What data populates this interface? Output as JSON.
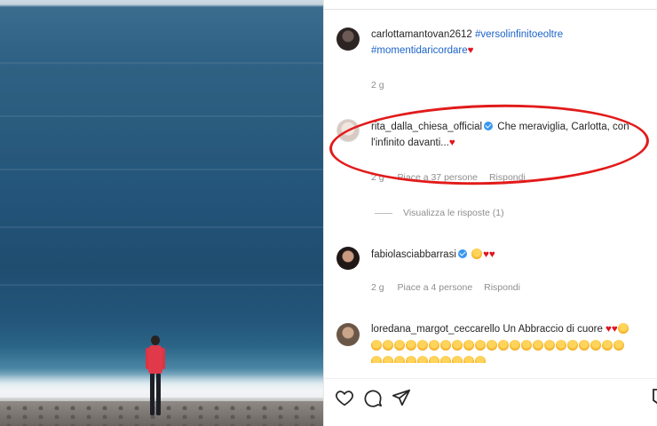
{
  "post": {
    "caption": {
      "user": "carlottamantovan2612",
      "tags": [
        "#versolinfinitoeoltre",
        "#momentidaricordare"
      ],
      "heart": "♥",
      "time": "2 g"
    },
    "comments": [
      {
        "user": "rita_dalla_chiesa_official",
        "text": "Che meraviglia, Carlotta, con l'infinito davanti...",
        "heart": "♥",
        "time": "2 g",
        "likes": "Piace a 37 persone",
        "reply": "Rispondi",
        "view_replies": "Visualizza le risposte (1)"
      },
      {
        "user": "fabiolasciabbarrasi",
        "time": "2 g",
        "likes": "Piace a 4 persone",
        "reply": "Rispondi"
      },
      {
        "user": "loredana_margot_ceccarello",
        "text": "Un Abbraccio di cuore"
      }
    ]
  },
  "actions": {
    "like_icon": "heart-outline-icon",
    "comment_icon": "comment-bubble-icon",
    "share_icon": "paper-plane-icon"
  },
  "colors": {
    "highlight_oval": "#e21a1a",
    "hashtag": "#1c64c9",
    "verified": "#3897f0"
  }
}
